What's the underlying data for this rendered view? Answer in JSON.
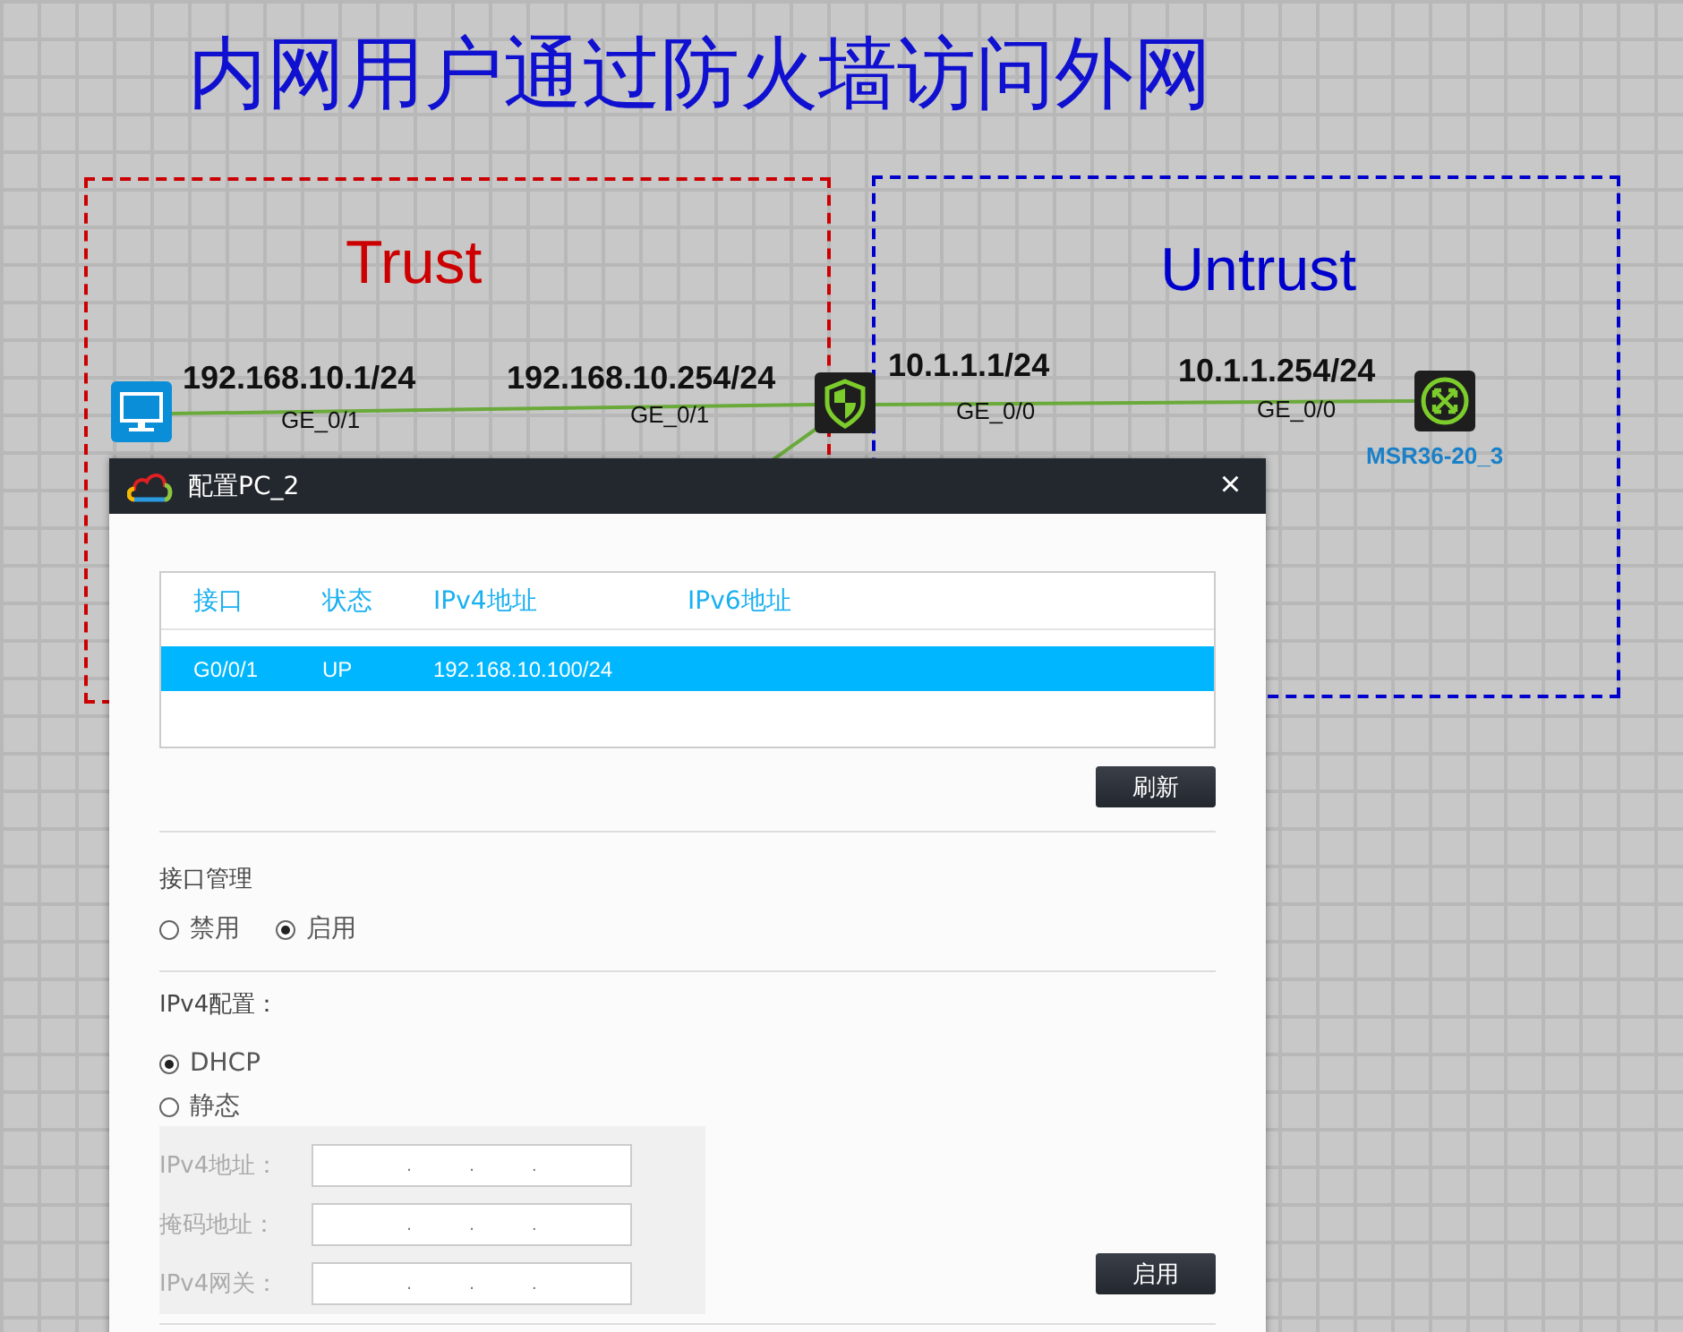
{
  "title": "内网用户通过防火墙访问外网",
  "zones": [
    {
      "label": "Trust",
      "color": "#cc0000"
    },
    {
      "label": "Untrust",
      "color": "#0000cc"
    }
  ],
  "devices": [
    {
      "kind": "pc"
    },
    {
      "kind": "firewall"
    },
    {
      "kind": "router",
      "name": "MSR36-20_3"
    }
  ],
  "link_labels": [
    {
      "ip": "192.168.10.1/24",
      "port": "GE_0/1"
    },
    {
      "ip": "192.168.10.254/24",
      "port": "GE_0/1"
    },
    {
      "ip": "10.1.1.1/24",
      "port": "GE_0/0"
    },
    {
      "ip": "10.1.1.254/24",
      "port": "GE_0/0"
    }
  ],
  "dialog": {
    "title": "配置PC_2",
    "close": "×",
    "table": {
      "columns": [
        "接口",
        "状态",
        "IPv4地址",
        "IPv6地址"
      ],
      "rows": [
        {
          "cells": [
            "G0/0/1",
            "UP",
            "192.168.10.100/24",
            ""
          ],
          "selected": true
        }
      ]
    },
    "refresh_button": "刷新",
    "interface_admin": {
      "label": "接口管理",
      "options": [
        {
          "label": "禁用",
          "selected": false
        },
        {
          "label": "启用",
          "selected": true
        }
      ]
    },
    "ipv4": {
      "label": "IPv4配置：",
      "options": [
        {
          "label": "DHCP",
          "selected": true
        },
        {
          "label": "静态",
          "selected": false
        }
      ],
      "separator": ".",
      "fields": [
        {
          "label": "IPv4地址："
        },
        {
          "label": "掩码地址："
        },
        {
          "label": "IPv4网关："
        }
      ],
      "apply_button": "启用"
    }
  }
}
